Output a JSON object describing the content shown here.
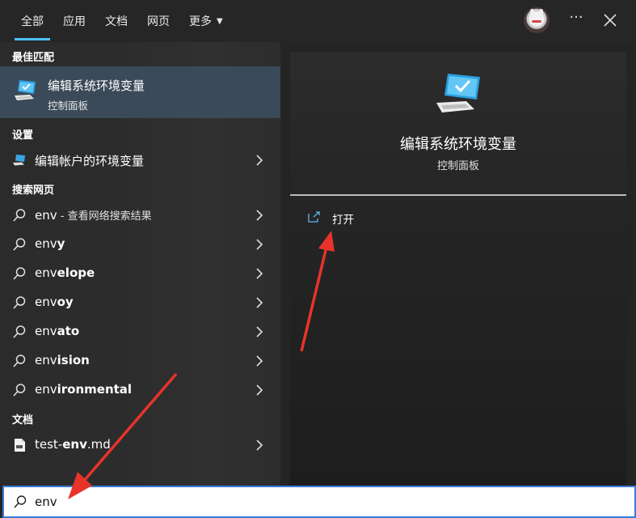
{
  "tabs": [
    {
      "label": "全部",
      "active": true
    },
    {
      "label": "应用"
    },
    {
      "label": "文档"
    },
    {
      "label": "网页"
    },
    {
      "label": "更多"
    }
  ],
  "header": {
    "more_options_label": "···"
  },
  "sections": {
    "best_match": "最佳匹配",
    "settings": "设置",
    "search_web": "搜索网页",
    "documents": "文档"
  },
  "best_match": {
    "title": "编辑系统环境变量",
    "subtitle": "控制面板",
    "icon": "control-panel-monitor-icon"
  },
  "settings_items": [
    {
      "label": "编辑帐户的环境变量",
      "icon": "settings-monitor-icon"
    }
  ],
  "web_results": [
    {
      "prefix": "env",
      "suffix": "",
      "hint": " - 查看网络搜索结果"
    },
    {
      "prefix": "env",
      "suffix": "y",
      "hint": ""
    },
    {
      "prefix": "env",
      "suffix": "elope",
      "hint": ""
    },
    {
      "prefix": "env",
      "suffix": "oy",
      "hint": ""
    },
    {
      "prefix": "env",
      "suffix": "ato",
      "hint": ""
    },
    {
      "prefix": "env",
      "suffix": "ision",
      "hint": ""
    },
    {
      "prefix": "env",
      "suffix": "ironmental",
      "hint": ""
    }
  ],
  "documents": [
    {
      "prefix": "test-",
      "bold": "env",
      "suffix": ".md",
      "icon": "markdown-file-icon"
    }
  ],
  "preview": {
    "title": "编辑系统环境变量",
    "subtitle": "控制面板",
    "actions": [
      {
        "label": "打开",
        "icon": "open-external-icon"
      }
    ]
  },
  "search": {
    "value": "env",
    "placeholder": ""
  },
  "colors": {
    "accent": "#4cc2ff",
    "selected_row": "#3b4a59",
    "annotation_arrow": "#e8332b"
  }
}
